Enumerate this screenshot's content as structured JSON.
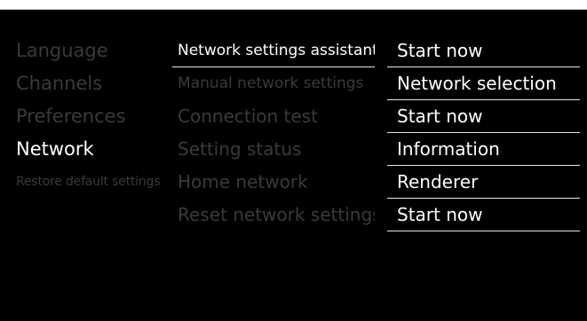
{
  "menu": {
    "categories": [
      {
        "label": "Language",
        "active": false
      },
      {
        "label": "Channels",
        "active": false
      },
      {
        "label": "Preferences",
        "active": false
      },
      {
        "label": "Network",
        "active": true
      },
      {
        "label": "Restore default settings",
        "active": false
      }
    ],
    "network_items": [
      {
        "label": "Network settings assistant",
        "active": true
      },
      {
        "label": "Manual network settings",
        "active": false
      },
      {
        "label": "Connection test",
        "active": false
      },
      {
        "label": "Setting status",
        "active": false
      },
      {
        "label": "Home network",
        "active": false
      },
      {
        "label": "Reset network settings",
        "active": false
      }
    ],
    "actions": [
      {
        "label": "Start now"
      },
      {
        "label": "Network selection"
      },
      {
        "label": "Start now"
      },
      {
        "label": "Information"
      },
      {
        "label": "Renderer"
      },
      {
        "label": "Start now"
      }
    ]
  },
  "colors": {
    "background": "#000000",
    "active_text": "#ffffff",
    "inactive_text": "#3a3a3a",
    "divider": "#e6e6e6"
  }
}
